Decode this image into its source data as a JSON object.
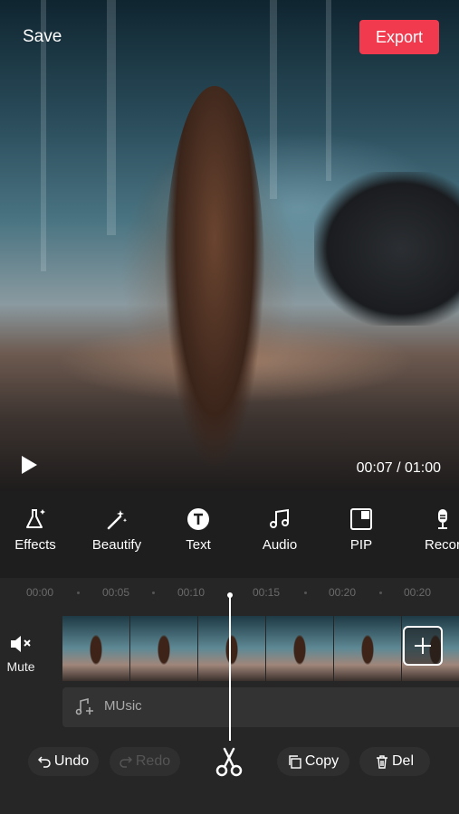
{
  "header": {
    "save_label": "Save",
    "export_label": "Export"
  },
  "player": {
    "timecode": "00:07 / 01:00",
    "play_icon": "play-icon"
  },
  "tools": [
    {
      "label": "Effects",
      "icon": "flask-sparkle-icon"
    },
    {
      "label": "Beautify",
      "icon": "magic-wand-icon"
    },
    {
      "label": "Text",
      "icon": "text-t-icon"
    },
    {
      "label": "Audio",
      "icon": "music-note-icon"
    },
    {
      "label": "PIP",
      "icon": "pip-icon"
    },
    {
      "label": "Recor",
      "icon": "microphone-icon"
    }
  ],
  "timeline": {
    "ruler": [
      "00:00",
      "00:05",
      "00:10",
      "00:15",
      "00:20",
      "00:20"
    ],
    "mute_label": "Mute",
    "music_label": "MUsic"
  },
  "actions": {
    "undo_label": "Undo",
    "redo_label": "Redo",
    "copy_label": "Copy",
    "delete_label": "Del"
  },
  "colors": {
    "accent": "#f23a4f",
    "background": "#1b1b1b"
  }
}
